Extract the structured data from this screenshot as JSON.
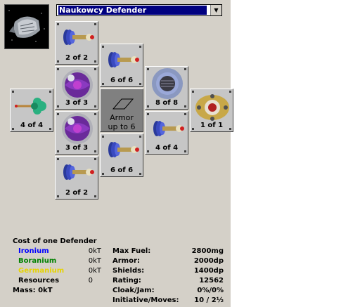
{
  "design": {
    "selected": "Naukowcy Defender"
  },
  "slots": {
    "s1": "2 of 2",
    "s2": "6 of 6",
    "s3": "3 of 3",
    "s4": "8 of 8",
    "s5": "4 of 4",
    "s6": "1 of 1",
    "s7": "3 of 3",
    "s8": "4 of 4",
    "s9": "6 of 6",
    "s10": "2 of 2"
  },
  "armor_slot": {
    "line1": "Armor",
    "line2": "up to 6"
  },
  "cost": {
    "title": "Cost of one Defender",
    "ironium": {
      "label": "Ironium",
      "value": "0kT",
      "color": "#0000ff"
    },
    "boranium": {
      "label": "Boranium",
      "value": "0kT",
      "color": "#008000"
    },
    "germanium": {
      "label": "Germanium",
      "value": "0kT",
      "color": "#e6d300"
    },
    "resources": {
      "label": "Resources",
      "value": "0"
    },
    "mass": "Mass: 0kT"
  },
  "stats": {
    "fuel": {
      "label": "Max Fuel:",
      "value": "2800mg"
    },
    "armor": {
      "label": "Armor:",
      "value": "2000dp"
    },
    "shields": {
      "label": "Shields:",
      "value": "1400dp"
    },
    "rating": {
      "label": "Rating:",
      "value": "12562"
    },
    "cloak": {
      "label": "Cloak/Jam:",
      "value": "0%/0%"
    },
    "init": {
      "label": "Initiative/Moves:",
      "value": "10 / 2½"
    }
  },
  "icons": {
    "weapon": "missile-launcher-icon",
    "shield": "shield-sphere-icon",
    "bomb": "mine-sphere-icon",
    "scanner": "scanner-dome-icon",
    "engine": "engine-icon",
    "hull": "starbase-hull-icon"
  }
}
